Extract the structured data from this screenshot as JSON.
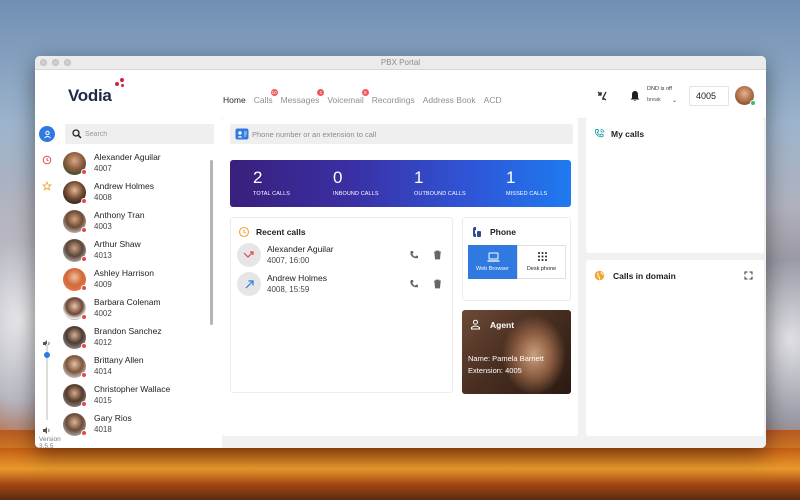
{
  "window": {
    "title": "PBX Portal"
  },
  "brand": {
    "name": "Vodia",
    "accent": "#d5213e"
  },
  "nav": {
    "tabs": [
      {
        "label": "Home",
        "active": true,
        "badge": ""
      },
      {
        "label": "Calls",
        "active": false,
        "badge": "10"
      },
      {
        "label": "Messages",
        "active": false,
        "badge": "1"
      },
      {
        "label": "Voicemail",
        "active": false,
        "badge": "5"
      },
      {
        "label": "Recordings",
        "active": false,
        "badge": ""
      },
      {
        "label": "Address Book",
        "active": false,
        "badge": ""
      },
      {
        "label": "ACD",
        "active": false,
        "badge": ""
      }
    ]
  },
  "header": {
    "dnd_status": "DND is off",
    "dnd_select": "break",
    "my_extension": "4005"
  },
  "sidebar": {
    "search_placeholder": "Search",
    "version": "Version 3.5.5",
    "contacts": [
      {
        "name": "Alexander Aguilar",
        "ext": "4007"
      },
      {
        "name": "Andrew Holmes",
        "ext": "4008"
      },
      {
        "name": "Anthony Tran",
        "ext": "4003"
      },
      {
        "name": "Arthur Shaw",
        "ext": "4013"
      },
      {
        "name": "Ashley Harrison",
        "ext": "4009"
      },
      {
        "name": "Barbara Colenam",
        "ext": "4002"
      },
      {
        "name": "Brandon Sanchez",
        "ext": "4012"
      },
      {
        "name": "Brittany Allen",
        "ext": "4014"
      },
      {
        "name": "Christopher Wallace",
        "ext": "4015"
      },
      {
        "name": "Gary Rios",
        "ext": "4018"
      }
    ]
  },
  "main": {
    "call_placeholder": "Phone number or an extension to call",
    "stats": [
      {
        "value": "2",
        "label": "TOTAL CALLS"
      },
      {
        "value": "0",
        "label": "INBOUND CALLS"
      },
      {
        "value": "1",
        "label": "OUTBOUND CALLS"
      },
      {
        "value": "1",
        "label": "MISSED CALLS"
      }
    ],
    "recent_calls": {
      "title": "Recent calls",
      "items": [
        {
          "name": "Alexander Aguilar",
          "sub": "4007, 16:00",
          "direction": "missed"
        },
        {
          "name": "Andrew Holmes",
          "sub": "4008, 15:59",
          "direction": "outbound"
        }
      ]
    },
    "phone": {
      "title": "Phone",
      "options": [
        {
          "label": "Web Browser",
          "selected": true
        },
        {
          "label": "Desk phone",
          "selected": false
        }
      ]
    },
    "agent": {
      "title": "Agent",
      "name_line": "Name: Pamela Barnett",
      "ext_line": "Extension: 4005"
    },
    "my_calls": {
      "title": "My calls"
    },
    "calls_in_domain": {
      "title": "Calls in domain"
    }
  },
  "colors": {
    "primary": "#2f79e0",
    "badge": "#ee5a5a",
    "offline": "#e24a4a",
    "online": "#2ec36b"
  }
}
